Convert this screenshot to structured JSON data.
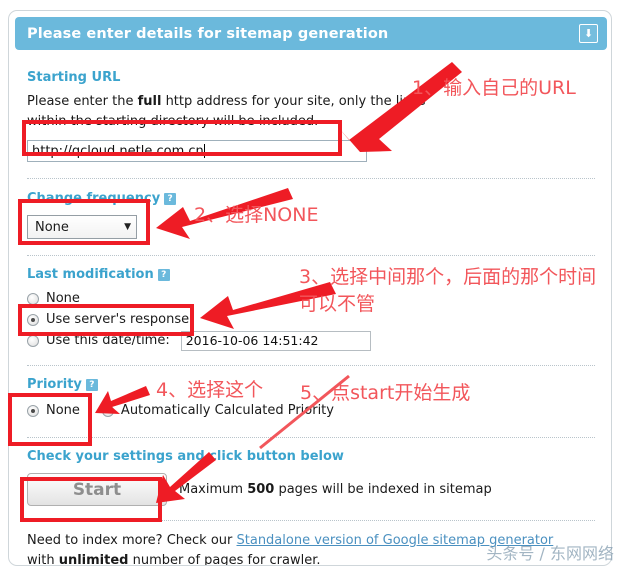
{
  "panel": {
    "title": "Please enter details for sitemap generation",
    "collapse_icon": "collapse-arrow-icon"
  },
  "starting_url": {
    "label": "Starting URL",
    "hint_prefix": "Please enter the ",
    "hint_bold": "full",
    "hint_suffix": " http address for your site, only the links within the starting directory will be included.",
    "value": "http://qcloud.netle.com.cn"
  },
  "change_frequency": {
    "label": "Change frequency",
    "help": "?",
    "selected": "None"
  },
  "last_modification": {
    "label": "Last modification",
    "help": "?",
    "options": [
      {
        "label": "None",
        "checked": false
      },
      {
        "label": "Use server's response",
        "checked": true
      },
      {
        "label": "Use this date/time:",
        "checked": false
      }
    ],
    "datetime_value": "2016-10-06 14:51:42"
  },
  "priority": {
    "label": "Priority",
    "help": "?",
    "options": [
      {
        "label": "None",
        "checked": true
      },
      {
        "label": "Automatically Calculated Priority",
        "checked": false
      }
    ]
  },
  "start": {
    "check_label": "Check your settings and click button below",
    "button_label": "Start",
    "note_prefix": "Maximum ",
    "note_bold": "500",
    "note_suffix": " pages will be indexed in sitemap"
  },
  "footer": {
    "line1_prefix": "Need to index more? Check our ",
    "line1_link": "Standalone version of Google sitemap generator",
    "line2_prefix": "with ",
    "line2_bold": "unlimited",
    "line2_suffix": " number of pages for crawler."
  },
  "annotations": [
    {
      "id": "anno-1",
      "text": "1、输入自己的URL"
    },
    {
      "id": "anno-2",
      "text": "2、选择NONE"
    },
    {
      "id": "anno-3-line1",
      "text": "3、选择中间那个，后面的那个时间"
    },
    {
      "id": "anno-3-line2",
      "text": "可以不管"
    },
    {
      "id": "anno-4",
      "text": "4、选择这个"
    },
    {
      "id": "anno-5",
      "text": "5、点start开始生成"
    }
  ],
  "watermark": {
    "text": "头条号 / 东网网络"
  },
  "colors": {
    "header_blue": "#6bb9dc",
    "label_blue": "#3ba3cd",
    "annotation_red": "#ee1c25",
    "annotation_text_red": "#f2565b"
  }
}
